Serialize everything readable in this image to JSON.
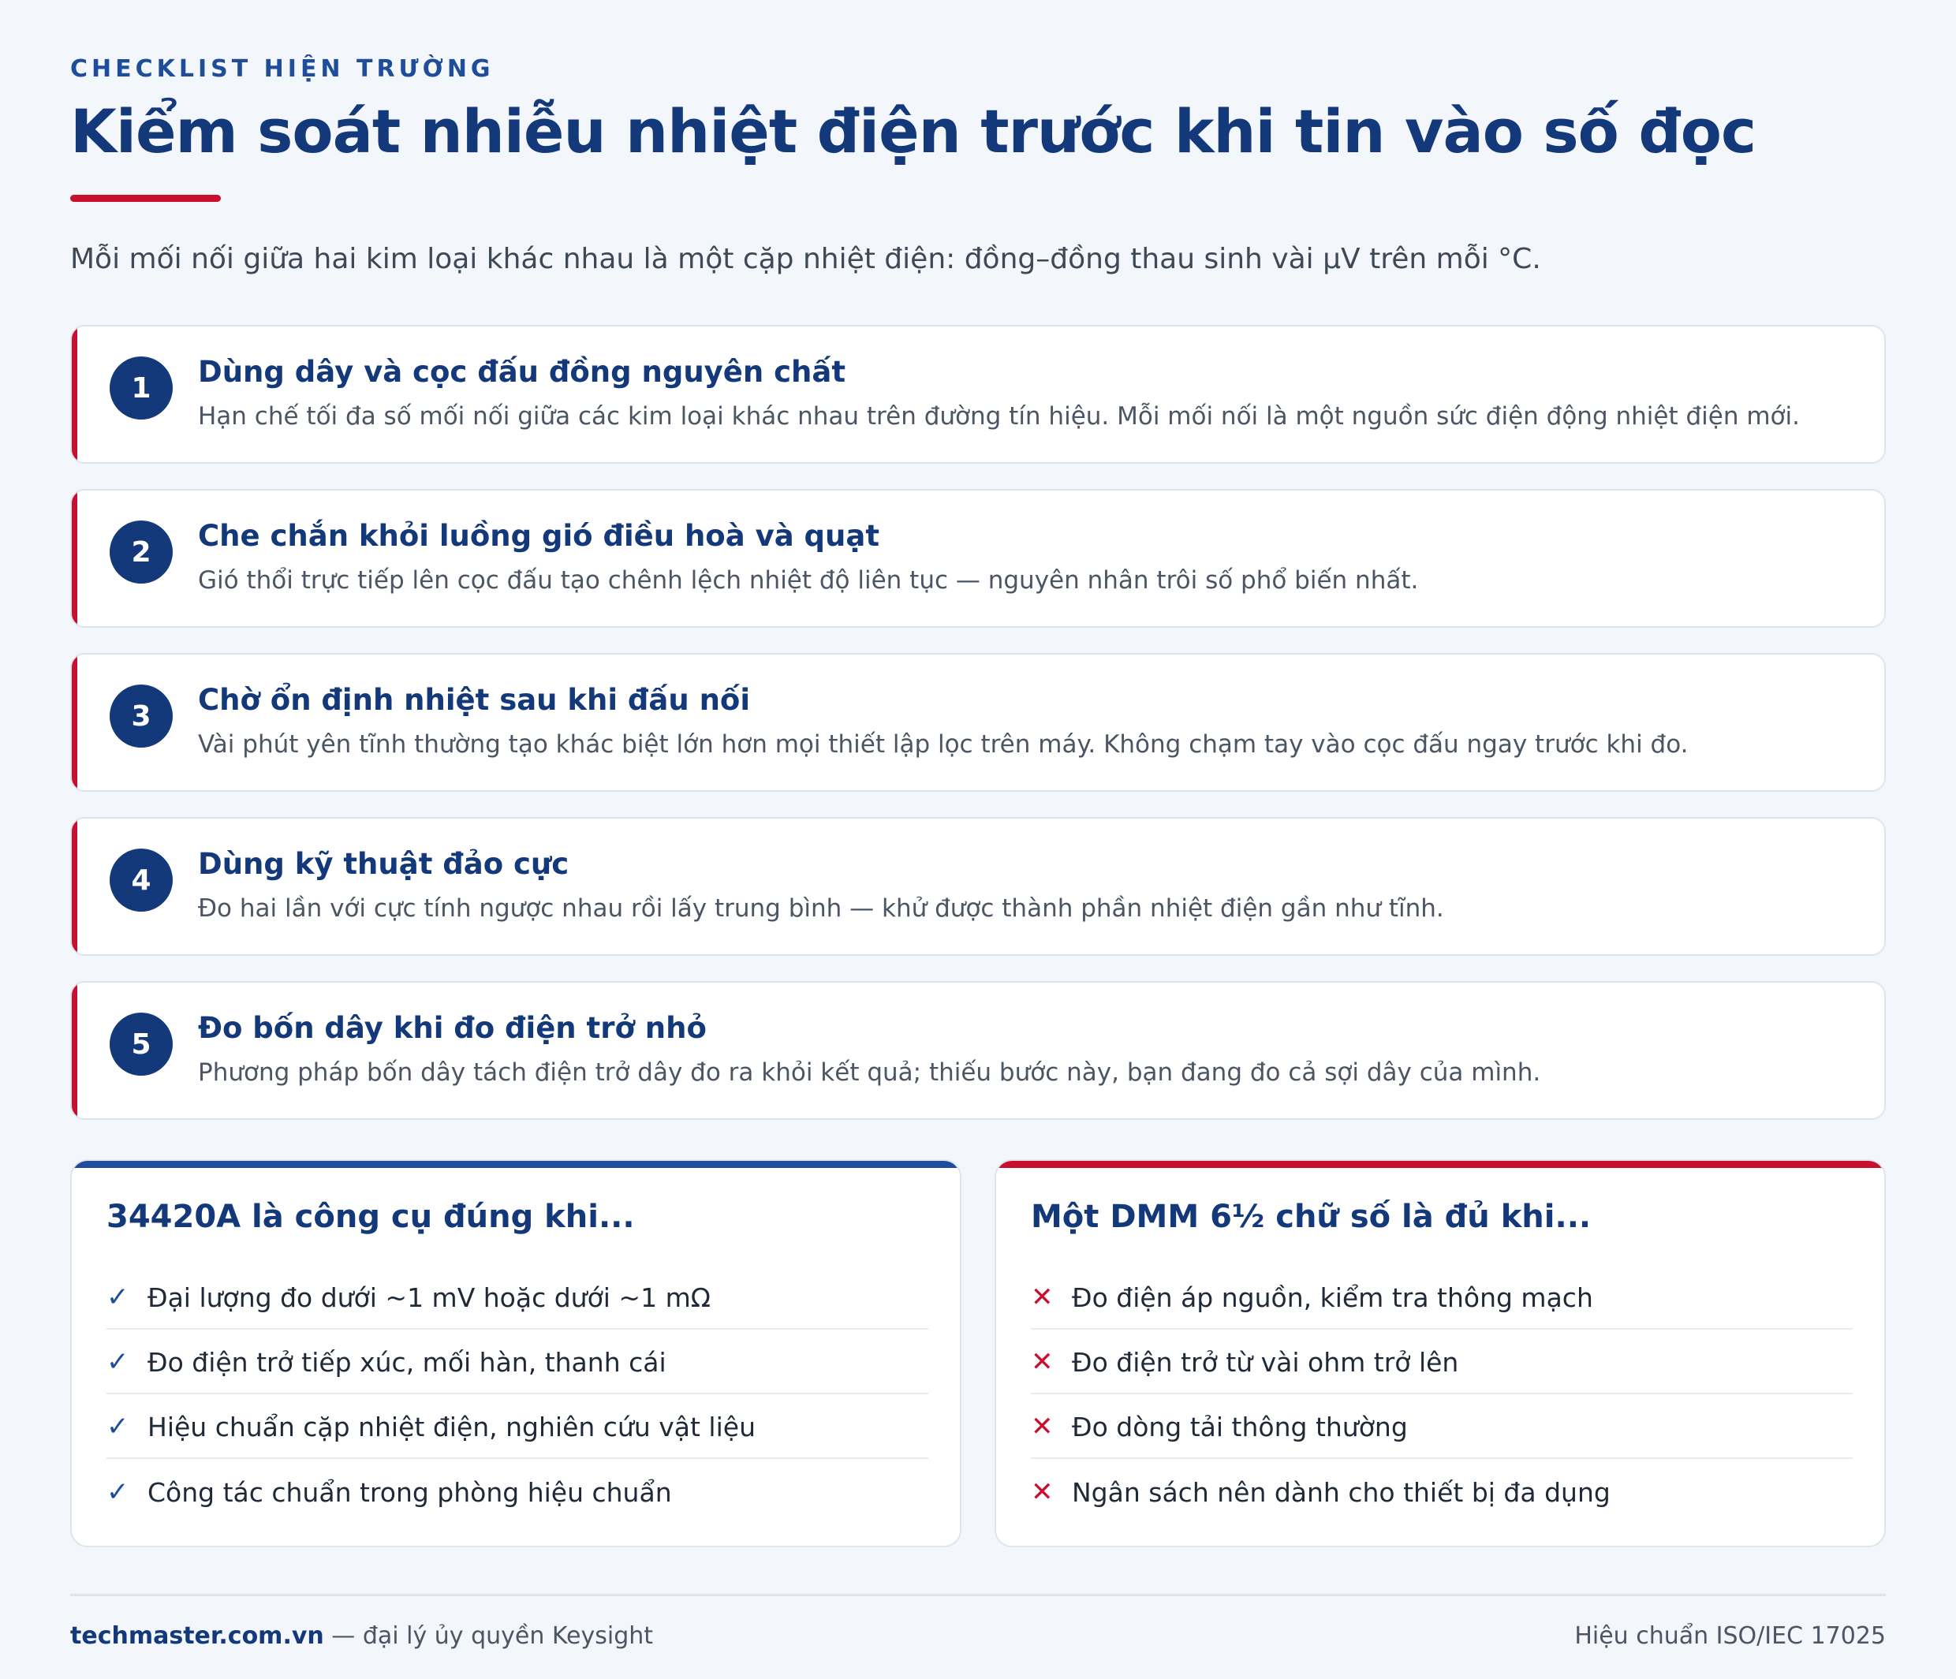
{
  "header": {
    "eyebrow": "CHECKLIST HIỆN TRƯỜNG",
    "title": "Kiểm soát nhiễu nhiệt điện trước khi tin vào số đọc",
    "intro": "Mỗi mối nối giữa hai kim loại khác nhau là một cặp nhiệt điện: đồng–đồng thau sinh vài µV trên mỗi °C."
  },
  "steps": [
    {
      "number": "1",
      "title": "Dùng dây và cọc đấu đồng nguyên chất",
      "desc": "Hạn chế tối đa số mối nối giữa các kim loại khác nhau trên đường tín hiệu. Mỗi mối nối là một nguồn sức điện động nhiệt điện mới."
    },
    {
      "number": "2",
      "title": "Che chắn khỏi luồng gió điều hoà và quạt",
      "desc": "Gió thổi trực tiếp lên cọc đấu tạo chênh lệch nhiệt độ liên tục — nguyên nhân trôi số phổ biến nhất."
    },
    {
      "number": "3",
      "title": "Chờ ổn định nhiệt sau khi đấu nối",
      "desc": "Vài phút yên tĩnh thường tạo khác biệt lớn hơn mọi thiết lập lọc trên máy. Không chạm tay vào cọc đấu ngay trước khi đo."
    },
    {
      "number": "4",
      "title": "Dùng kỹ thuật đảo cực",
      "desc": "Đo hai lần với cực tính ngược nhau rồi lấy trung bình — khử được thành phần nhiệt điện gần như tĩnh."
    },
    {
      "number": "5",
      "title": "Đo bốn dây khi đo điện trở nhỏ",
      "desc": "Phương pháp bốn dây tách điện trở dây đo ra khỏi kết quả; thiếu bước này, bạn đang đo cả sợi dây của mình."
    }
  ],
  "panels": {
    "left": {
      "title": "34420A là công cụ đúng khi...",
      "mark": "✓",
      "mark_icon": "check-icon",
      "accent": "#1e4d9b",
      "items": [
        "Đại lượng đo dưới ~1 mV hoặc dưới ~1 mΩ",
        "Đo điện trở tiếp xúc, mối hàn, thanh cái",
        "Hiệu chuẩn cặp nhiệt điện, nghiên cứu vật liệu",
        "Công tác chuẩn trong phòng hiệu chuẩn"
      ]
    },
    "right": {
      "title": "Một DMM 6½ chữ số là đủ khi...",
      "mark": "✕",
      "mark_icon": "cross-icon",
      "accent": "#c8102e",
      "items": [
        "Đo điện áp nguồn, kiểm tra thông mạch",
        "Đo điện trở từ vài ohm trở lên",
        "Đo dòng tải thông thường",
        "Ngân sách nên dành cho thiết bị đa dụng"
      ]
    }
  },
  "footer": {
    "site": "techmaster.com.vn",
    "tagline": " — đại lý ủy quyền Keysight",
    "certification": "Hiệu chuẩn ISO/IEC 17025"
  },
  "colors": {
    "navy": "#13397a",
    "blue": "#1e4d9b",
    "red": "#c8102e",
    "background": "#f3f6fb"
  }
}
